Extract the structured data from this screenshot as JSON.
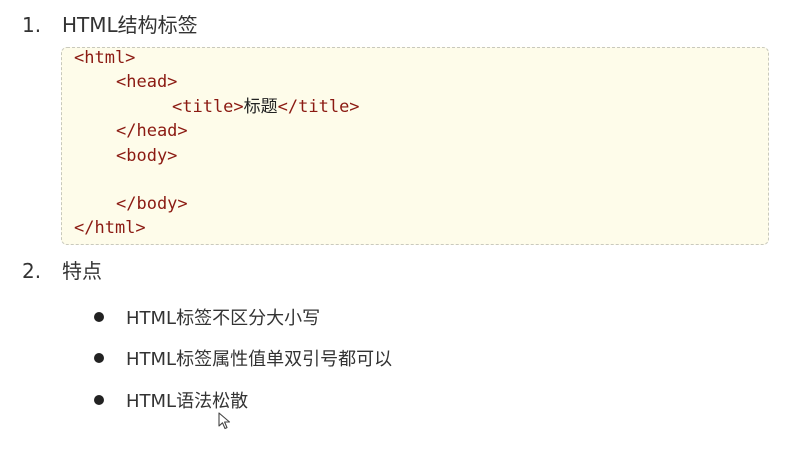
{
  "sections": [
    {
      "number": "1.",
      "title": "HTML结构标签"
    },
    {
      "number": "2.",
      "title": "特点"
    }
  ],
  "code": [
    {
      "tag": "<html>",
      "text": "",
      "close": ""
    },
    {
      "tag": "<head>",
      "text": "",
      "close": ""
    },
    {
      "tag": "<title>",
      "text": "标题",
      "close": "</title>"
    },
    {
      "tag": "</head>",
      "text": "",
      "close": ""
    },
    {
      "tag": "<body>",
      "text": "",
      "close": ""
    },
    {
      "tag": "</body>",
      "text": "",
      "close": ""
    },
    {
      "tag": "</html>",
      "text": "",
      "close": ""
    }
  ],
  "features": [
    "HTML标签不区分大小写",
    "HTML标签属性值单双引号都可以",
    "HTML语法松散"
  ],
  "colors": {
    "code_background": "#fefcea",
    "code_tag": "#8b1a12",
    "text": "#333333"
  },
  "icons": {
    "cursor": "mouse-pointer-icon"
  }
}
